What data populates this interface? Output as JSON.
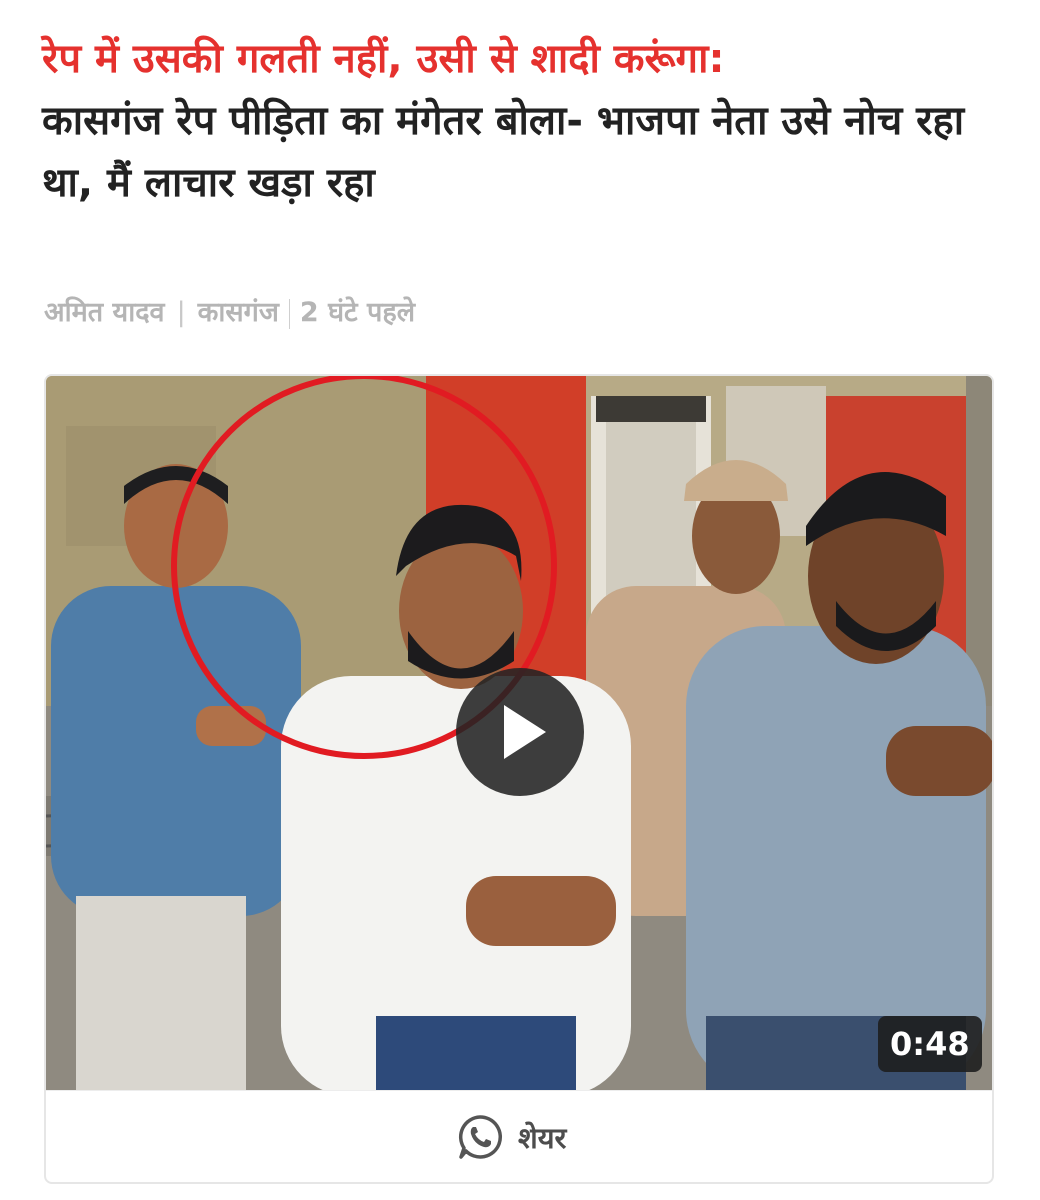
{
  "article": {
    "headline_kicker": "रेप में उसकी गलती नहीं, उसी से शादी करूंगा:",
    "headline_rest": "कासगंज रेप पीड़िता का मंगेतर बोला- भाजपा नेता उसे नोच रहा था, मैं लाचार खड़ा रहा",
    "author": "अमित यादव",
    "location": "कासगंज",
    "time_ago": "2 घंटे पहले"
  },
  "video": {
    "duration": "0:48",
    "play_icon": "play-icon",
    "highlight_color": "#e11b22"
  },
  "share": {
    "label": "शेयर",
    "icon": "whatsapp-icon"
  },
  "colors": {
    "kicker": "#e5312e",
    "headline": "#222222",
    "byline": "#b5b5b5"
  }
}
